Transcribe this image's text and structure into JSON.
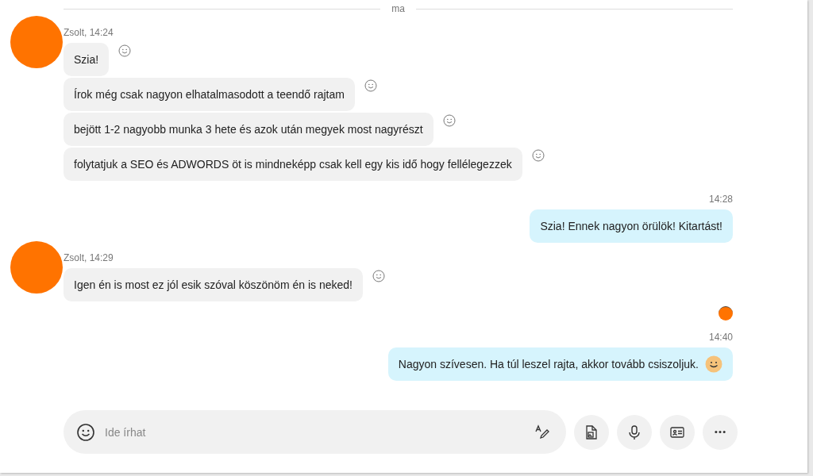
{
  "date_divider": "ma",
  "groups": [
    {
      "kind": "incoming",
      "header": "Zsolt, 14:24",
      "messages": [
        {
          "text": "Szia!",
          "emoji": false
        },
        {
          "text": "Írok még csak nagyon elhatalmasodott a teendő rajtam",
          "emoji": false
        },
        {
          "text": "bejött 1-2 nagyobb munka 3 hete és azok után megyek most nagyrészt",
          "emoji": false
        },
        {
          "text": "folytatjuk a SEO és ADWORDS öt is mindneképp csak kell egy kis idő hogy fellélegezzek",
          "emoji": false
        }
      ]
    },
    {
      "kind": "outgoing",
      "header": "14:28",
      "messages": [
        {
          "text": "Szia! Ennek nagyon örülök! Kitartást!",
          "emoji": false
        }
      ]
    },
    {
      "kind": "incoming",
      "header": "Zsolt, 14:29",
      "messages": [
        {
          "text": "Igen én is most ez jól esik szóval köszönöm én is neked!",
          "emoji": false
        }
      ]
    },
    {
      "kind": "read_receipt"
    },
    {
      "kind": "outgoing",
      "header": "14:40",
      "messages": [
        {
          "text": "Nagyon szívesen. Ha túl leszel rajta, akkor tovább csiszoljuk.",
          "emoji": true
        }
      ]
    }
  ],
  "composer": {
    "placeholder": "Ide írhat"
  }
}
